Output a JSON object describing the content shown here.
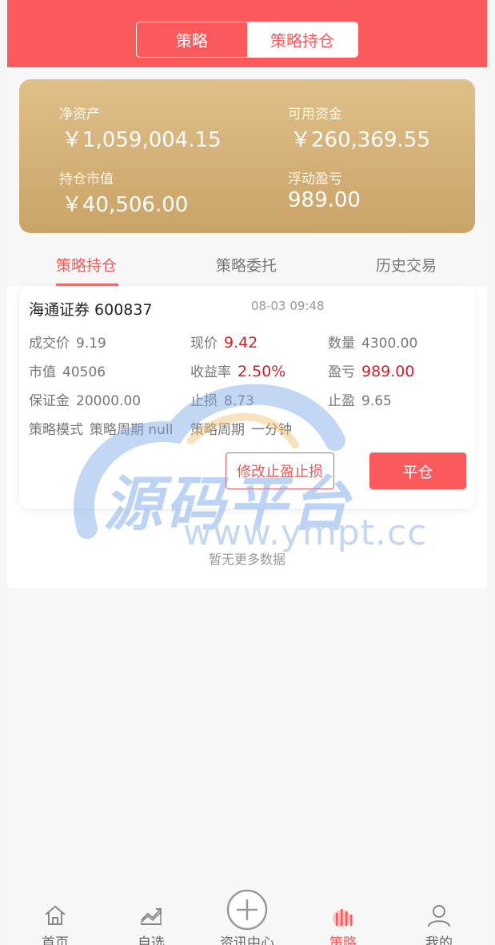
{
  "header": {
    "seg_strategy": "策略",
    "seg_positions": "策略持仓"
  },
  "summary": {
    "net_assets_label": "净资产",
    "net_assets_value": "￥1,059,004.15",
    "available_funds_label": "可用资金",
    "available_funds_value": "￥260,369.55",
    "position_value_label": "持仓市值",
    "position_value_value": "￥40,506.00",
    "floating_pl_label": "浮动盈亏",
    "floating_pl_value": "989.00"
  },
  "tabs": {
    "positions": "策略持仓",
    "orders": "策略委托",
    "history": "历史交易"
  },
  "card": {
    "name": "海通证券 600837",
    "time": "08-03 09:48",
    "deal_price_label": "成交价",
    "deal_price": "9.19",
    "current_price_label": "现价",
    "current_price": "9.42",
    "quantity_label": "数量",
    "quantity": "4300.00",
    "market_value_label": "市值",
    "market_value": "40506",
    "return_rate_label": "收益率",
    "return_rate": "2.50%",
    "pl_label": "盈亏",
    "pl": "989.00",
    "margin_label": "保证金",
    "margin": "20000.00",
    "stop_loss_label": "止损",
    "stop_loss": "8.73",
    "take_profit_label": "止盈",
    "take_profit": "9.65",
    "mode_label": "策略模式",
    "mode": "策略周期 null",
    "period_label": "策略周期",
    "period": "一分钟",
    "edit_button": "修改止盈止损",
    "close_button": "平仓"
  },
  "no_more": "暂无更多数据",
  "watermark": {
    "title": "源码平台",
    "url": "www.ympt.cc"
  },
  "tabbar": {
    "home": "首页",
    "watchlist": "自选",
    "news": "资讯中心",
    "strategy": "策略",
    "mine": "我的"
  },
  "colors": {
    "brand_red": "#fb5a5c",
    "gold_top": "#dfc08a",
    "gold_bottom": "#caa367",
    "profit_red": "#d0202a"
  }
}
